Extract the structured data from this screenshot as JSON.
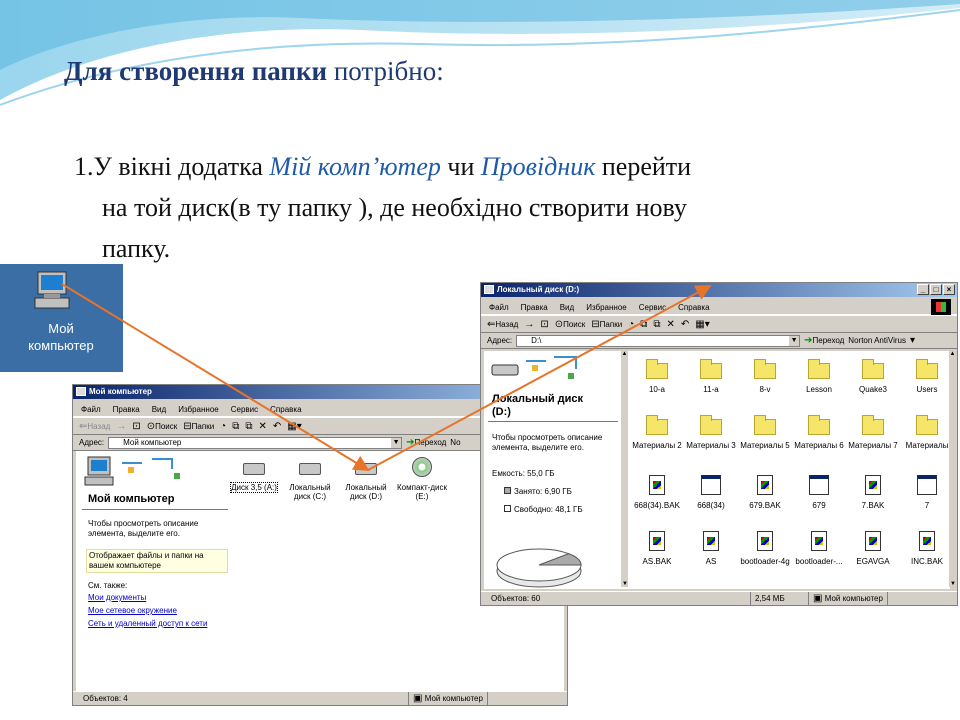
{
  "slide": {
    "title_bold": "Для створення папки",
    "title_rest": " потрібно:",
    "line1_a": "1.У вікні додатка ",
    "line1_b": "Мій комп’ютер",
    "line1_c": " чи ",
    "line1_d": "Провідник",
    "line1_e": " перейти",
    "line2": "на той диск(в ту папку ), де необхідно створити нову",
    "line3": "папку."
  },
  "desktop_icon": {
    "label_1": "Мой",
    "label_2": "компьютер",
    "icon": "computer-icon"
  },
  "win1": {
    "title": "Мой компьютер",
    "menu": [
      "Файл",
      "Правка",
      "Вид",
      "Избранное",
      "Сервис",
      "Справка"
    ],
    "toolbar": {
      "back": "Назад",
      "search": "Поиск",
      "folders": "Папки"
    },
    "address_label": "Адрес:",
    "address_value": "Мой компьютер",
    "go": "Переход",
    "go_cut": "No",
    "panel_title": "Мой компьютер",
    "panel_desc": "Чтобы просмотреть описание элемента, выделите его.",
    "panel_hint": "Отображает файлы и папки на вашем компьютере",
    "see_also": "См. также:",
    "links": [
      "Мои документы",
      "Мое сетевое окружение",
      "Сеть и удаленный доступ к сети"
    ],
    "drives": [
      {
        "label": "Диск 3,5 (A:)",
        "icon": "floppy-drive-icon"
      },
      {
        "label": "Локальный диск (C:)",
        "icon": "hard-drive-icon"
      },
      {
        "label": "Локальный диск (D:)",
        "icon": "hard-drive-icon"
      },
      {
        "label": "Компакт-диск (E:)",
        "icon": "cd-drive-icon"
      }
    ],
    "status_count": "Объектов: 4",
    "status_loc": "Мой компьютер"
  },
  "win2": {
    "title": "Локальный диск (D:)",
    "menu": [
      "Файл",
      "Правка",
      "Вид",
      "Избранное",
      "Сервис",
      "Справка"
    ],
    "toolbar": {
      "back": "Назад",
      "search": "Поиск",
      "folders": "Папки"
    },
    "address_label": "Адрес:",
    "address_value": "D:\\",
    "go": "Переход",
    "norton": "Norton AntiVirus",
    "panel_title_1": "Локальный диск",
    "panel_title_2": "(D:)",
    "panel_desc": "Чтобы просмотреть описание элемента, выделите его.",
    "capacity": "Емкость: 55,0 ГБ",
    "used": "Занято: 6,90 ГБ",
    "free": "Свободно: 48,1 ГБ",
    "used_fraction": 0.125,
    "items_row1": [
      "10-a",
      "11-a",
      "8-v",
      "Lesson",
      "Quake3",
      "Users"
    ],
    "items_row2": [
      "Материалы 2",
      "Материалы 3",
      "Материалы 5",
      "Материалы 6",
      "Материалы 7",
      "Материалы"
    ],
    "items_row3": [
      "668(34).BAK",
      "668(34)",
      "679.BAK",
      "679",
      "7.BAK",
      "7"
    ],
    "items_row4": [
      "AS.BAK",
      "AS",
      "bootloader-4g",
      "bootloader-...",
      "EGAVGA",
      "INC.BAK"
    ],
    "status_count": "Объектов: 60",
    "status_size": "2,54 МБ",
    "status_loc": "Мой компьютер"
  },
  "colors": {
    "arrow": "#e8742a",
    "titlebar": "#0a246a",
    "desktop": "#3a6ea5"
  }
}
